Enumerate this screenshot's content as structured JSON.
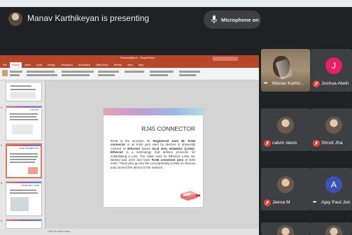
{
  "header": {
    "presenting_text": "Manav Karthikeyan is presenting",
    "mic_label": "Microphone on"
  },
  "powerpoint": {
    "window_title": "Presentation1 - PowerPoint",
    "search_placeholder": "Search",
    "tabs": [
      "File",
      "Home",
      "Insert",
      "Draw",
      "Design",
      "Transitions",
      "Animations",
      "Slide Show",
      "Review",
      "View",
      "Help"
    ],
    "active_tab": "Home",
    "thumbnails": [
      {
        "num": "2",
        "title": ""
      },
      {
        "num": "3",
        "title": "LISTOOL"
      },
      {
        "num": "4",
        "title": "RJ45 CONNECTOR"
      },
      {
        "num": "5",
        "title": "ETHERNET CARD"
      },
      {
        "num": "6",
        "title": ""
      }
    ],
    "slide": {
      "title": "RJ45 CONNECTOR",
      "body_html_parts": [
        {
          "t": "RJ45 is the acronym for ",
          "b": false
        },
        {
          "t": "Registered Jack 45. RJ45 connector",
          "b": true
        },
        {
          "t": " is an 8-pin jack used by devices to physically connect to ",
          "b": false
        },
        {
          "t": "Ethernet",
          "b": true
        },
        {
          "t": " based ",
          "b": false
        },
        {
          "t": "local area networks (LANs)",
          "b": true
        },
        {
          "t": ". ",
          "b": false
        },
        {
          "t": "Ethernet",
          "b": true
        },
        {
          "t": " is a technology that defines protocols for establishing a LAN. The cable used for Ethernet LANs are twisted pair ones and have ",
          "b": false
        },
        {
          "t": "RJ45 connector pins",
          "b": true
        },
        {
          "t": " at both ends. These pins go into the corresponding socket on devices and connect the device to the network.",
          "b": false
        }
      ]
    },
    "status_text": "Click to add notes"
  },
  "participants": [
    {
      "name": "Manav Karthi...",
      "type": "video",
      "muted": false
    },
    {
      "name": "Joshua Alwin",
      "initial": "J",
      "color": "#e91e63",
      "muted": true
    },
    {
      "name": "calvin davis",
      "type": "photo",
      "muted": true
    },
    {
      "name": "Shruti Jha",
      "type": "photo",
      "muted": true
    },
    {
      "name": "Jeeva M",
      "type": "photo",
      "muted": true
    },
    {
      "name": "Ajay Paul Jon",
      "initial": "A",
      "color": "#3f51b5",
      "muted": false
    },
    {
      "name": "",
      "type": "photo",
      "muted": false
    },
    {
      "name": "",
      "type": "photo",
      "muted": false
    }
  ],
  "colors": {
    "meet_bg": "#202124",
    "tile_bg": "#3c4043",
    "ppt_accent": "#b7472a",
    "mute_red": "#ea4335"
  },
  "icons": [
    "microphone-icon",
    "mic-off-icon",
    "more-options-icon"
  ]
}
